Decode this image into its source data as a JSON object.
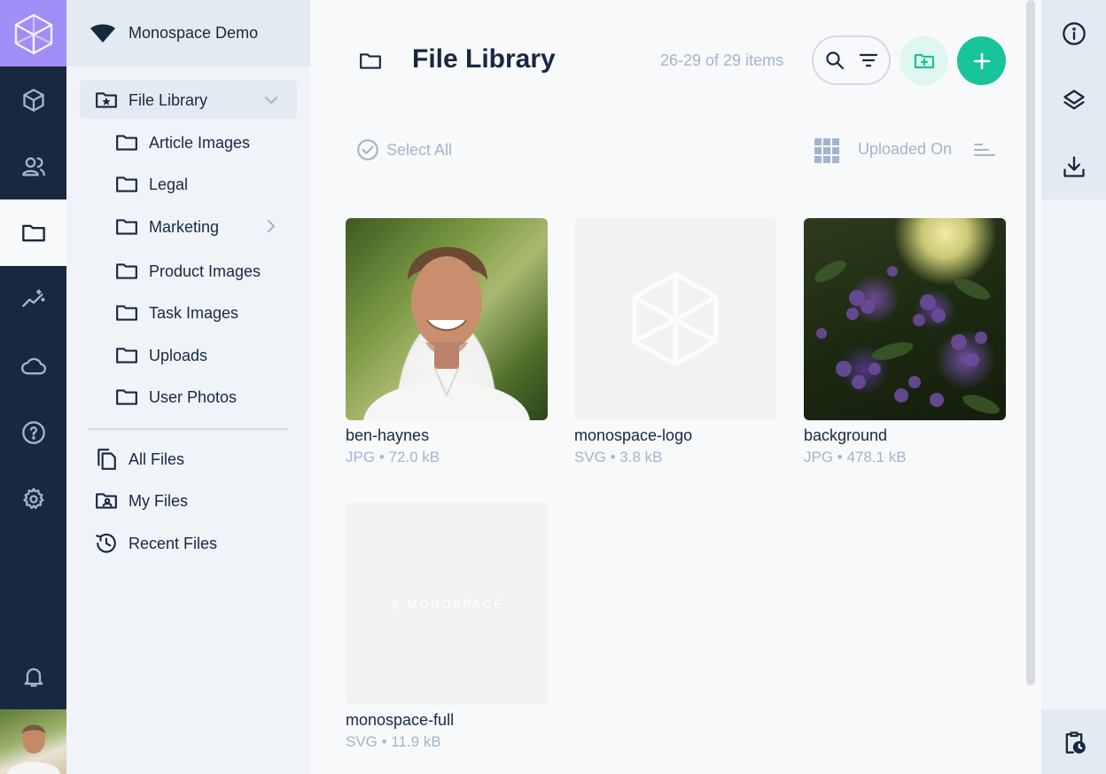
{
  "project": {
    "name": "Monospace Demo"
  },
  "module_bar": {
    "items": [
      {
        "icon": "box-icon"
      },
      {
        "icon": "users-icon"
      },
      {
        "icon": "folder-icon",
        "active": true
      },
      {
        "icon": "insights-icon"
      },
      {
        "icon": "cloud-icon"
      },
      {
        "icon": "help-icon"
      },
      {
        "icon": "gear-icon"
      }
    ],
    "notifications_icon": "bell-icon"
  },
  "nav": {
    "root": {
      "label": "File Library",
      "icon": "folder-star-icon"
    },
    "folders": [
      {
        "label": "Article Images"
      },
      {
        "label": "Legal"
      },
      {
        "label": "Marketing",
        "has_children": true
      },
      {
        "label": "Product Images"
      },
      {
        "label": "Task Images"
      },
      {
        "label": "Uploads"
      },
      {
        "label": "User Photos"
      }
    ],
    "special": [
      {
        "label": "All Files",
        "icon": "files-icon"
      },
      {
        "label": "My Files",
        "icon": "folder-user-icon"
      },
      {
        "label": "Recent Files",
        "icon": "history-icon"
      }
    ]
  },
  "header": {
    "title": "File Library",
    "count": "26-29 of 29 items"
  },
  "toolbar": {
    "select_all": "Select All",
    "sort_label": "Uploaded On"
  },
  "files": [
    {
      "name": "ben-haynes",
      "meta": "JPG • 72.0 kB"
    },
    {
      "name": "monospace-logo",
      "meta": "SVG • 3.8 kB"
    },
    {
      "name": "background",
      "meta": "JPG • 478.1 kB"
    },
    {
      "name": "monospace-full",
      "meta": "SVG • 11.9 kB",
      "wordmark": "⊕ MONOSPACE"
    }
  ],
  "colors": {
    "brand": "#a08df5",
    "accent": "#18c49a",
    "dark": "#172940",
    "muted": "#a3b5cd"
  }
}
